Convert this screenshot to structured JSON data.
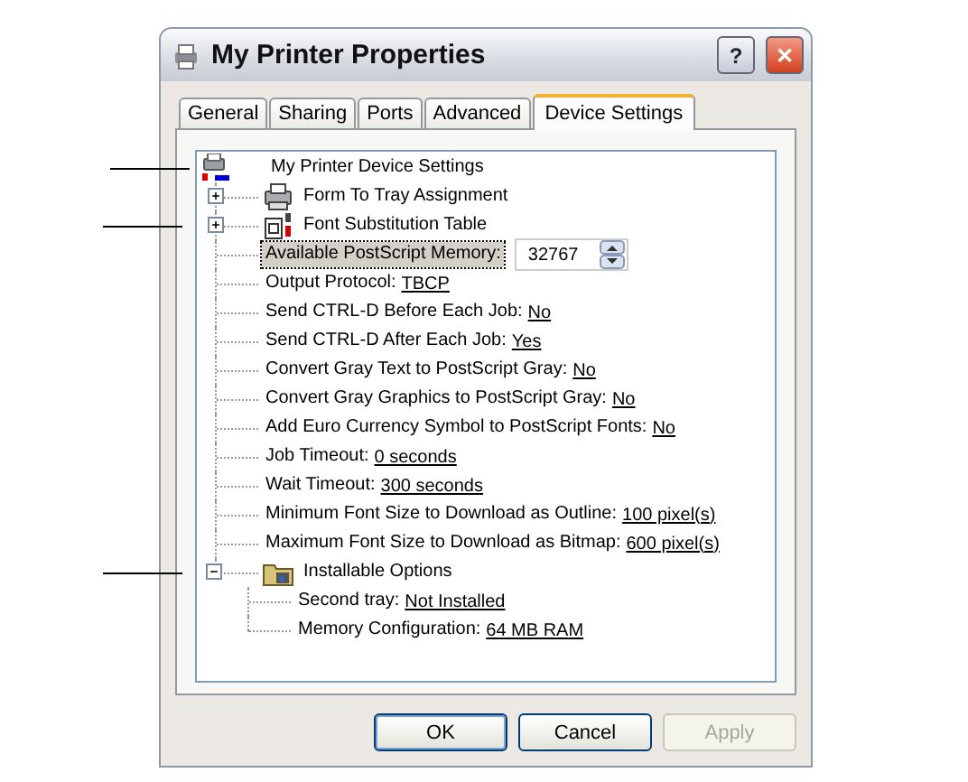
{
  "window": {
    "title": "My Printer Properties",
    "help_button": "?",
    "close_button": "✕"
  },
  "tabs": [
    {
      "label": "General",
      "selected": false
    },
    {
      "label": "Sharing",
      "selected": false
    },
    {
      "label": "Ports",
      "selected": false
    },
    {
      "label": "Advanced",
      "selected": false
    },
    {
      "label": "Device Settings",
      "selected": true
    }
  ],
  "tree": {
    "label": "My Printer Device Settings",
    "kind": "root",
    "selected": false,
    "callout": true,
    "children": [
      {
        "label": "Form To Tray Assignment",
        "kind": "trays",
        "selected": false,
        "expanded": false,
        "callout": false
      },
      {
        "label": "Font Substitution Table",
        "kind": "fonts",
        "selected": false,
        "expanded": false,
        "callout": true
      },
      {
        "label": "Available PostScript Memory:",
        "kind": "spin",
        "selected": true,
        "value": "32767",
        "callout": false
      },
      {
        "label": "Output Protocol:",
        "kind": "setting",
        "selected": false,
        "value": "TBCP",
        "callout": false
      },
      {
        "label": "Send CTRL-D Before Each Job:",
        "kind": "setting",
        "selected": false,
        "value": "No",
        "callout": false
      },
      {
        "label": "Send CTRL-D After Each Job:",
        "kind": "setting",
        "selected": false,
        "value": "Yes",
        "callout": false
      },
      {
        "label": "Convert Gray Text to PostScript Gray:",
        "kind": "setting",
        "selected": false,
        "value": "No",
        "callout": false
      },
      {
        "label": "Convert Gray Graphics to PostScript Gray:",
        "kind": "setting",
        "selected": false,
        "value": "No",
        "callout": false
      },
      {
        "label": "Add Euro Currency Symbol to PostScript Fonts:",
        "kind": "setting",
        "selected": false,
        "value": "No",
        "callout": false
      },
      {
        "label": "Job Timeout:",
        "kind": "setting",
        "selected": false,
        "value": "0 seconds",
        "callout": false
      },
      {
        "label": "Wait Timeout:",
        "kind": "setting",
        "selected": false,
        "value": "300 seconds",
        "callout": false
      },
      {
        "label": "Minimum Font Size to Download as Outline:",
        "kind": "setting",
        "selected": false,
        "value": "100 pixel(s)",
        "callout": false
      },
      {
        "label": "Maximum Font Size to Download as Bitmap:",
        "kind": "setting",
        "selected": false,
        "value": "600 pixel(s)",
        "callout": false
      },
      {
        "label": "Installable Options",
        "kind": "options",
        "selected": false,
        "expanded": true,
        "callout": true,
        "children": [
          {
            "label": "Second tray:",
            "kind": "setting",
            "selected": false,
            "value": "Not Installed",
            "callout": false
          },
          {
            "label": "Memory Configuration:",
            "kind": "setting",
            "selected": false,
            "value": "64 MB RAM",
            "callout": false
          }
        ]
      }
    ]
  },
  "buttons": [
    {
      "label": "OK",
      "default": true,
      "disabled": false
    },
    {
      "label": "Cancel",
      "default": false,
      "disabled": false
    },
    {
      "label": "Apply",
      "default": false,
      "disabled": true
    }
  ]
}
